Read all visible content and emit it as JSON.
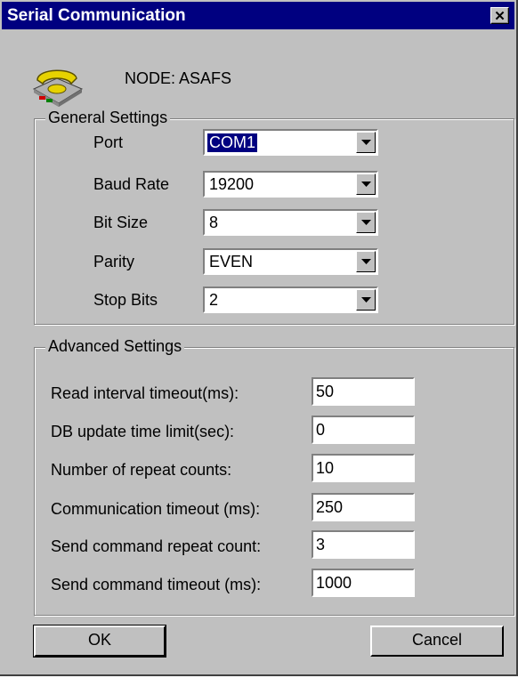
{
  "window": {
    "title": "Serial Communication",
    "close_label": "✕"
  },
  "node": {
    "label": "NODE: ASAFS"
  },
  "icons": {
    "node": "telephone-icon",
    "close": "close-icon",
    "dropdown": "chevron-down-icon"
  },
  "general": {
    "legend": "General Settings",
    "rows": [
      {
        "label": "Port",
        "value": "COM1"
      },
      {
        "label": "Baud Rate",
        "value": "19200"
      },
      {
        "label": "Bit Size",
        "value": "8"
      },
      {
        "label": "Parity",
        "value": "EVEN"
      },
      {
        "label": "Stop Bits",
        "value": "2"
      }
    ]
  },
  "advanced": {
    "legend": "Advanced Settings",
    "rows": [
      {
        "label": "Read interval timeout(ms):",
        "value": "50"
      },
      {
        "label": "DB update time limit(sec):",
        "value": "0"
      },
      {
        "label": "Number of repeat counts:",
        "value": "10"
      },
      {
        "label": "Communication timeout (ms):",
        "value": "250"
      },
      {
        "label": "Send command repeat count:",
        "value": "3"
      },
      {
        "label": "Send command timeout (ms):",
        "value": "1000"
      }
    ]
  },
  "buttons": {
    "ok": "OK",
    "cancel": "Cancel"
  },
  "colors": {
    "titlebar": "#000080",
    "face": "#c0c0c0",
    "selection": "#000080"
  }
}
